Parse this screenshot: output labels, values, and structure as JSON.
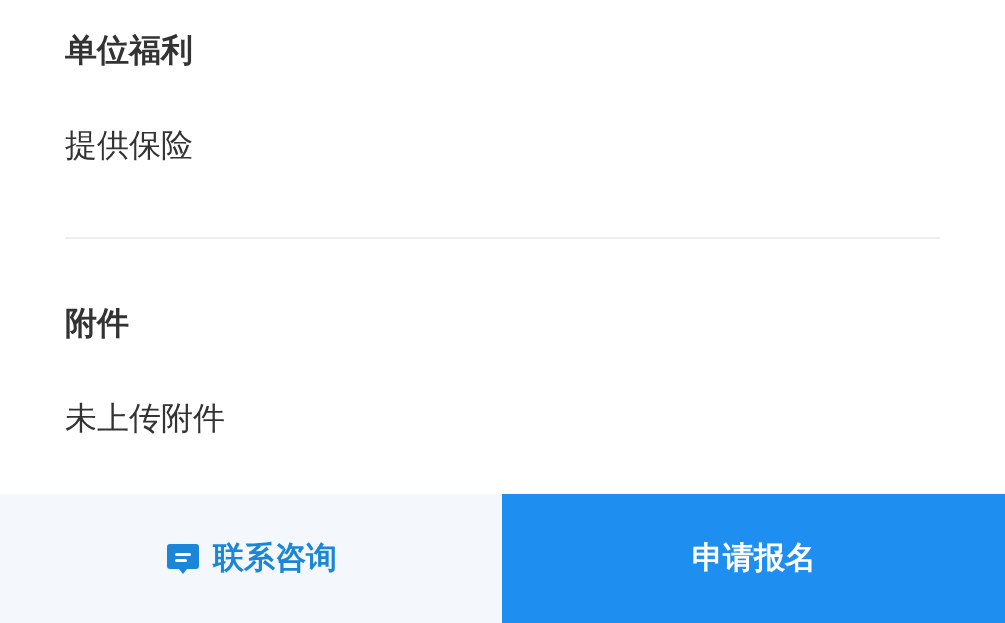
{
  "sections": [
    {
      "title": "单位福利",
      "value": "提供保险"
    },
    {
      "title": "附件",
      "value": "未上传附件"
    }
  ],
  "bottom_bar": {
    "contact_button": {
      "label": "联系咨询"
    },
    "apply_button": {
      "label": "申请报名"
    }
  }
}
